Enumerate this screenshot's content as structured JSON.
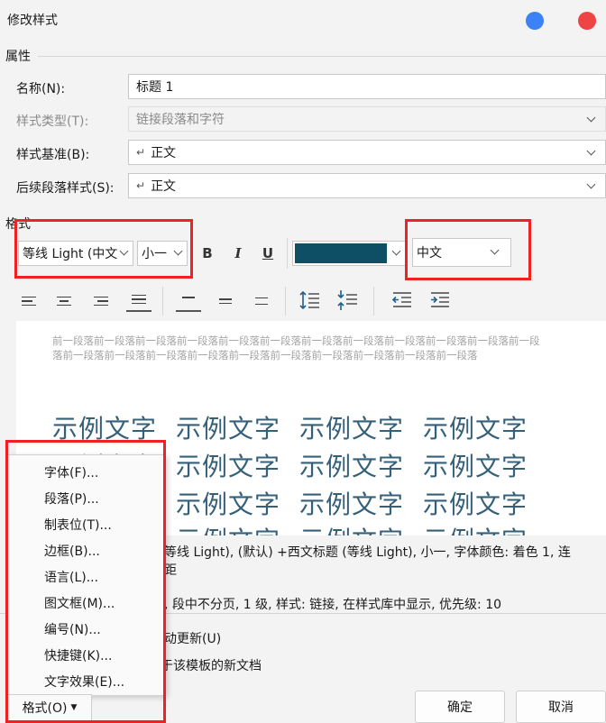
{
  "window": {
    "title": "修改样式"
  },
  "properties": {
    "section_label": "属性",
    "name_label": "名称(N):",
    "name_value": "标题 1",
    "type_label": "样式类型(T):",
    "type_value": "链接段落和字符",
    "based_on_label": "样式基准(B):",
    "based_on_value": "正文",
    "next_label": "后续段落样式(S):",
    "next_value": "正文",
    "para_mark": "↵"
  },
  "format": {
    "section_label": "格式",
    "font_value": "等线 Light (中文",
    "size_value": "小一",
    "bold": "B",
    "italic": "I",
    "underline": "U",
    "font_color": "#0f4f66",
    "script_value": "中文"
  },
  "preview": {
    "prev_para": "前一段落前一段落前一段落前一段落前一段落前一段落前一段落前一段落前一段落前一段落前一段落前一段落前一段落前一段落前一段落前一段落前一段落前一段落前一段落前一段落前一段落前一段落",
    "sample": "示例文字"
  },
  "description": {
    "line1": "等线 Light), (默认) +西文标题 (等线 Light), 小一, 字体颜色: 着色 1, 连",
    "line2": "距",
    "line3": ", 段中不分页, 1 级, 样式: 链接, 在样式库中显示, 优先级: 10"
  },
  "options": {
    "auto_update": "动更新(U)",
    "new_docs": "于该模板的新文档"
  },
  "menu": {
    "items": [
      "字体(F)...",
      "段落(P)...",
      "制表位(T)...",
      "边框(B)...",
      "语言(L)...",
      "图文框(M)...",
      "编号(N)...",
      "快捷键(K)...",
      "文字效果(E)..."
    ]
  },
  "footer": {
    "format_button": "格式(O)",
    "ok_button": "确定",
    "cancel_button": "取消"
  },
  "colors": {
    "accent_blue": "#3b82f6",
    "close_red": "#ef4444",
    "highlight": "#ee2222"
  }
}
